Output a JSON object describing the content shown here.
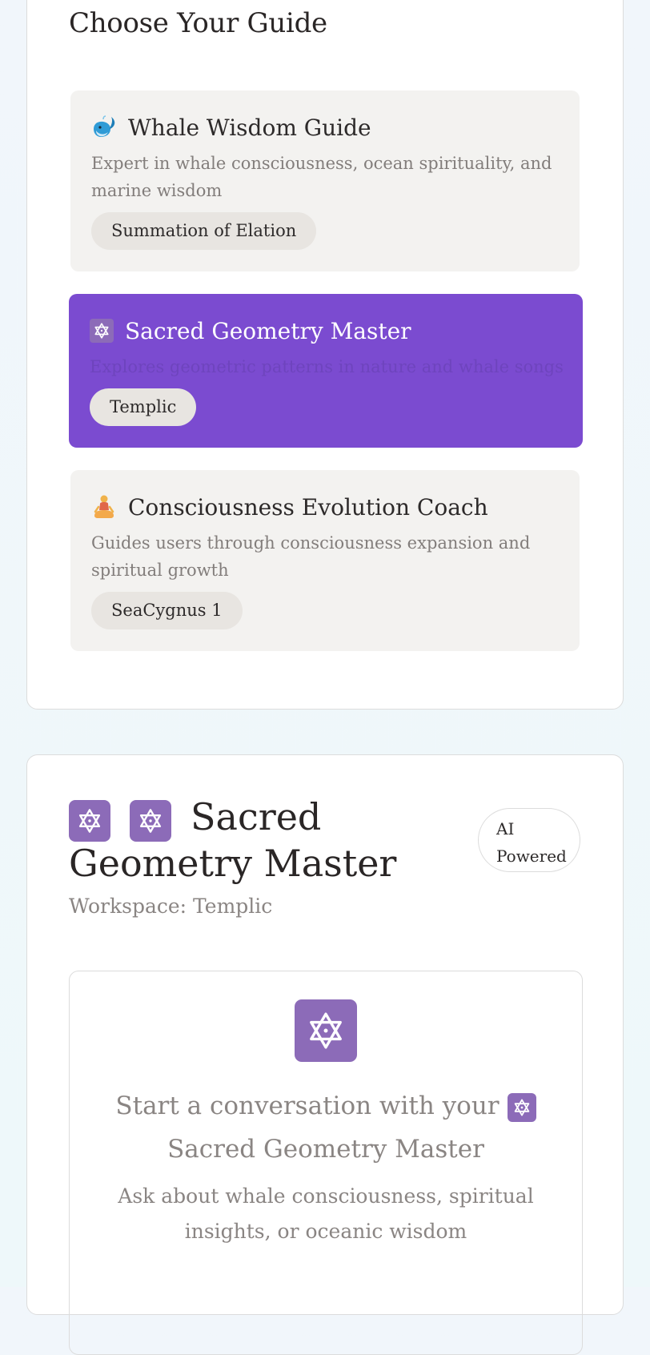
{
  "guides_section": {
    "title": "Choose Your Guide",
    "guides": [
      {
        "icon": "whale-icon",
        "name": "Whale Wisdom Guide",
        "description": "Expert in whale consciousness, ocean spirituality, and marine wisdom",
        "workspace": "Summation of Elation",
        "selected": false
      },
      {
        "icon": "star-of-david-icon",
        "name": "Sacred Geometry Master",
        "description": "Explores geometric patterns in nature and whale songs",
        "workspace": "Templic",
        "selected": true
      },
      {
        "icon": "meditating-person-icon",
        "name": "Consciousness Evolution Coach",
        "description": "Guides users through consciousness expansion and spiritual growth",
        "workspace": "SeaCygnus 1",
        "selected": false
      }
    ]
  },
  "chat": {
    "title": "Sacred Geometry Master",
    "badge_line1": "AI",
    "badge_line2": "Powered",
    "workspace_label": "Workspace: Templic",
    "empty_title": "Start a conversation with your",
    "empty_title_name": "Sacred Geometry Master",
    "empty_subtitle": "Ask about whale consciousness, spiritual insights, or oceanic wisdom"
  },
  "colors": {
    "accent": "#7b4bd0",
    "icon_tile": "#8c6bb8",
    "card_bg": "#f3f2f0",
    "chip_bg": "#e8e5e1"
  }
}
